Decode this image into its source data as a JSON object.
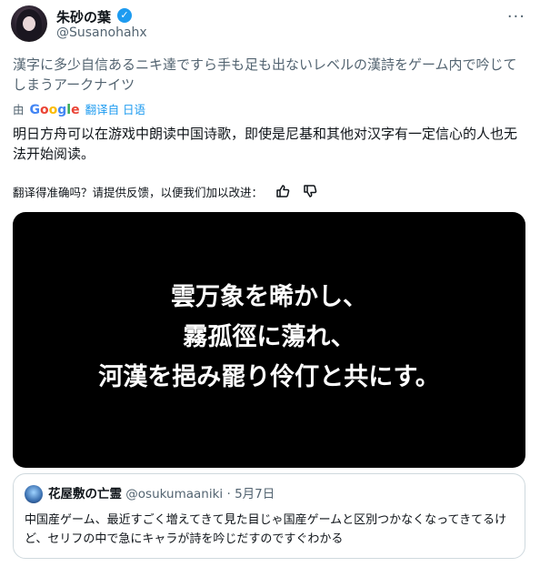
{
  "author": {
    "name": "朱砂の葉",
    "handle": "@Susanohahx"
  },
  "tweet": {
    "original_text": "漢字に多少自信あるニキ達ですら手も足も出ないレベルの漢詩をゲーム内で吟じてしまうアークナイツ",
    "translated_prefix": "由",
    "translator": "Google",
    "translated_from": "翻译自 日语",
    "translation": "明日方舟可以在游戏中朗读中国诗歌，即使是尼基和其他对汉字有一定信心的人也无法开始阅读。",
    "feedback_prompt": "翻译得准确吗？请提供反馈，以便我们加以改进："
  },
  "media": {
    "lines": [
      "雲万象を晞かし、",
      "霧孤徑に蕩れ、",
      "河漢を挹み罷り伶仃と共にす。"
    ]
  },
  "quote": {
    "name": "花屋敷の亡霊",
    "handle": "@osukumaaniki",
    "separator": "·",
    "date": "5月7日",
    "text": "中国産ゲーム、最近すごく増えてきて見た目じゃ国産ゲームと区別つかなくなってきてるけど、セリフの中で急にキャラが詩を吟じだすのですぐわかる"
  },
  "icons": {
    "verified": "verified-badge-icon",
    "more": "more-options-icon",
    "thumbs_up": "thumbs-up-icon",
    "thumbs_down": "thumbs-down-icon"
  },
  "colors": {
    "accent": "#1d9bf0",
    "secondary_text": "#536471"
  }
}
